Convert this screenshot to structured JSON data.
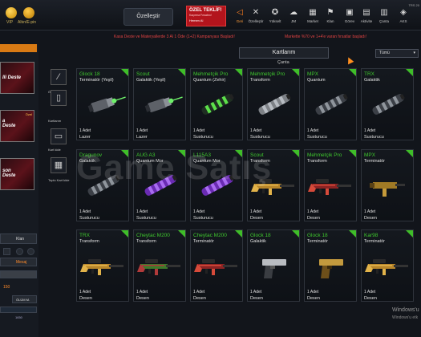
{
  "topbar": {
    "vip_label": "VIP",
    "altin_label": "Altın/E-pin",
    "ozellestir_label": "Özelleştir",
    "offer": {
      "title": "ÖZEL TEKLİF!",
      "subtitle": "Kaçırma Fırsatını!",
      "cta": "Hemen Al"
    },
    "nav": [
      {
        "label": "Geri",
        "icon": "back-icon",
        "glyph": "◁"
      },
      {
        "label": "Özelleştir",
        "icon": "customize-icon",
        "glyph": "✕"
      },
      {
        "label": "Yükselt",
        "icon": "upgrade-icon",
        "glyph": "✪"
      },
      {
        "label": "JM",
        "icon": "jm-icon",
        "glyph": "☁"
      },
      {
        "label": "Market",
        "icon": "market-icon",
        "glyph": "▦"
      },
      {
        "label": "Klan",
        "icon": "clan-icon",
        "glyph": "⚑"
      },
      {
        "label": "Görev",
        "icon": "mission-icon",
        "glyph": "▣"
      },
      {
        "label": "Aktivite",
        "icon": "activity-icon",
        "glyph": "▤"
      },
      {
        "label": "Çanta",
        "icon": "bag-icon",
        "glyph": "▥"
      },
      {
        "label": "AKS",
        "icon": "aks-icon",
        "glyph": "◈"
      }
    ],
    "tr_label": "TRS 20"
  },
  "banners": {
    "left": "Kasa Deste ve Materyallerde 3 Al 1 Öde (1+2) Kampanyası Başladı!",
    "right": "Markette %70 ve 1+4'e varan fırsatlar başladı!"
  },
  "left_panel": {
    "decks": [
      {
        "title": "lli Deste",
        "tag": ""
      },
      {
        "title": "a\nDeste",
        "tag": "Özel"
      },
      {
        "title": "son\nDeste",
        "tag": ""
      }
    ],
    "klan_label": "Klan",
    "mesaj_label": "Mesaj",
    "count": "150",
    "olum_label": "ÖLÜM M.",
    "bottom_num": "1650"
  },
  "tools": [
    {
      "label": "Özelleştirme",
      "icon": "magic-wand-icon",
      "glyph": "⁄"
    },
    {
      "label": "Kartlarım",
      "icon": "cards-icon",
      "glyph": "▯"
    },
    {
      "label": "Kart kide",
      "icon": "card-stack-icon",
      "glyph": "▭"
    },
    {
      "label": "Toplu Kart kide",
      "icon": "bulk-cards-icon",
      "glyph": "▦"
    }
  ],
  "header": {
    "title": "Kartlarım",
    "subtitle": "Çanta",
    "filter_value": "Tümü"
  },
  "cards": [
    {
      "name": "Glock 18",
      "type": "Terminatör (Yeşil)",
      "qty": "1 Adet",
      "category": "Lazer",
      "art": "laser"
    },
    {
      "name": "Scout",
      "type": "Galaktik (Yeşil)",
      "qty": "1 Adet",
      "category": "Lazer",
      "art": "laser"
    },
    {
      "name": "Mehmetçik Pro",
      "type": "Quantum (Zehir)",
      "qty": "1 Adet",
      "category": "Susturucu",
      "art": "supp-green"
    },
    {
      "name": "Mehmetçik Pro",
      "type": "Transform",
      "qty": "1 Adet",
      "category": "Susturucu",
      "art": "supp-gray"
    },
    {
      "name": "MPX",
      "type": "Quantum",
      "qty": "1 Adet",
      "category": "Susturucu",
      "art": "supp-dark"
    },
    {
      "name": "TRX",
      "type": "Galaktik",
      "qty": "1 Adet",
      "category": "Susturucu",
      "art": "supp-dark"
    },
    {
      "name": "Dragunov",
      "type": "Galaktik",
      "qty": "1 Adet",
      "category": "Susturucu",
      "art": "supp-dark"
    },
    {
      "name": "AUG A3",
      "type": "Quantum Mor",
      "qty": "1 Adet",
      "category": "Susturucu",
      "art": "supp-purple"
    },
    {
      "name": "L115A3",
      "type": "Quantum Mor",
      "qty": "1 Adet",
      "category": "Susturucu",
      "art": "supp-purple"
    },
    {
      "name": "Scout",
      "type": "Transform",
      "qty": "1 Adet",
      "category": "Desen",
      "art": "rifle-gold"
    },
    {
      "name": "Mehmetçik Pro",
      "type": "Transform",
      "qty": "1 Adet",
      "category": "Desen",
      "art": "rifle-red"
    },
    {
      "name": "MPX",
      "type": "Terminatör",
      "qty": "1 Adet",
      "category": "Desen",
      "art": "smg-gold"
    },
    {
      "name": "TRX",
      "type": "Transform",
      "qty": "1 Adet",
      "category": "Desen",
      "art": "rifle-gold"
    },
    {
      "name": "Cheytac M200",
      "type": "Transform",
      "qty": "1 Adet",
      "category": "Desen",
      "art": "rifle-green"
    },
    {
      "name": "Cheytac M200",
      "type": "Terminatör",
      "qty": "1 Adet",
      "category": "Desen",
      "art": "rifle-red"
    },
    {
      "name": "Glock 18",
      "type": "Galaktik",
      "qty": "1 Adet",
      "category": "Desen",
      "art": "pistol"
    },
    {
      "name": "Glock 18",
      "type": "Terminatör",
      "qty": "1 Adet",
      "category": "Desen",
      "art": "pistol-gold"
    },
    {
      "name": "Kar98",
      "type": "Terminatör",
      "qty": "1 Adet",
      "category": "Desen",
      "art": "rifle-gold"
    }
  ],
  "watermark": "Game Satış",
  "windows": {
    "line1": "Windows'u",
    "line2": "Windows'u etk"
  },
  "colors": {
    "accent_green": "#3fc92e",
    "accent_orange": "#ff7f1f",
    "banner_red": "#e04242"
  }
}
